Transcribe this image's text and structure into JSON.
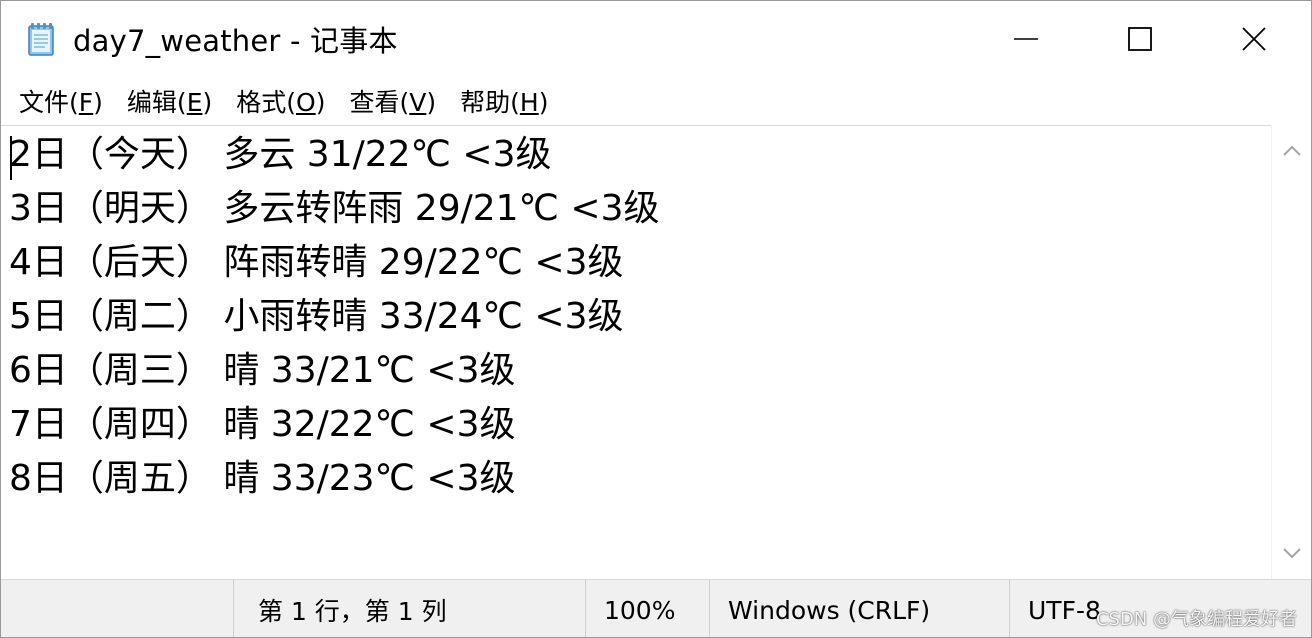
{
  "window": {
    "title": "day7_weather - 记事本",
    "app_icon": "notepad-icon",
    "controls": [
      "minimize-icon",
      "maximize-icon",
      "close-icon"
    ]
  },
  "menu": {
    "items": [
      {
        "label": "文件(",
        "key": "F",
        "end": ")"
      },
      {
        "label": "编辑(",
        "key": "E",
        "end": ")"
      },
      {
        "label": "格式(",
        "key": "O",
        "end": ")"
      },
      {
        "label": "查看(",
        "key": "V",
        "end": ")"
      },
      {
        "label": "帮助(",
        "key": "H",
        "end": ")"
      }
    ]
  },
  "editor": {
    "lines": [
      "2日（今天） 多云 31/22℃ <3级",
      "3日（明天） 多云转阵雨 29/21℃ <3级",
      "4日（后天） 阵雨转晴 29/22℃ <3级",
      "5日（周二） 小雨转晴 33/24℃ <3级",
      "6日（周三） 晴 33/21℃ <3级",
      "7日（周四） 晴 32/22℃ <3级",
      "8日（周五） 晴 33/23℃ <3级"
    ]
  },
  "scrollbar": {
    "up_icon": "chevron-up-icon",
    "down_icon": "chevron-down-icon"
  },
  "status": {
    "position": "第 1 行，第 1 列",
    "zoom": "100%",
    "line_ending": "Windows (CRLF)",
    "encoding": "UTF-8"
  },
  "watermark": "CSDN @气象编程爱好者"
}
